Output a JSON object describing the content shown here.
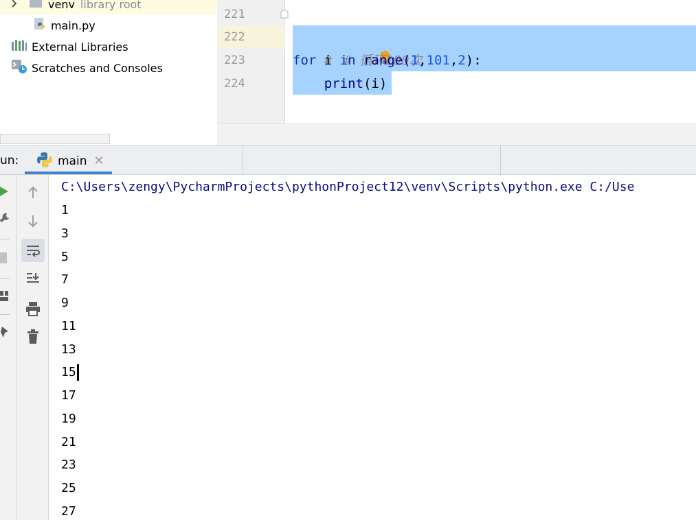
{
  "project_tree": {
    "items": [
      {
        "label": "venv",
        "suffix": "library root",
        "icon": "folder-icon"
      },
      {
        "label": "main.py",
        "icon": "python-file-icon"
      },
      {
        "label": "External Libraries",
        "icon": "libraries-icon"
      },
      {
        "label": "Scratches and Consoles",
        "icon": "scratches-icon"
      }
    ]
  },
  "editor": {
    "line_numbers": [
      "221",
      "222",
      "223",
      "224"
    ],
    "lines": {
      "comment_hash": "#",
      "comment_text": "# 循环100次",
      "for_kw": "for",
      "var_i": " i ",
      "in_kw": "in",
      "range_fn": " range(",
      "arg1": "1",
      "comma1": ",",
      "arg2": "101",
      "comma2": ",",
      "arg3": "2",
      "close": "):",
      "print_indent": "    ",
      "print_fn": "print",
      "print_args": "(i)"
    },
    "intention_bulb_icon": "lightbulb-icon"
  },
  "run_panel": {
    "label": "un:",
    "tab_name": "main",
    "tab_icon": "python-icon",
    "close_icon": "close-icon",
    "toolbar": [
      "up-arrow-icon",
      "down-arrow-icon",
      "soft-wrap-icon",
      "scroll-to-end-icon",
      "print-icon",
      "trash-icon"
    ],
    "left_toolbar": [
      "run-icon",
      "wrench-icon",
      "stop-icon",
      "layout-icon",
      "pin-icon"
    ]
  },
  "console": {
    "command": "C:\\Users\\zengy\\PycharmProjects\\pythonProject12\\venv\\Scripts\\python.exe C:/Use",
    "output": [
      "1",
      "3",
      "5",
      "7",
      "9",
      "11",
      "13",
      "15",
      "17",
      "19",
      "21",
      "23",
      "25",
      "27"
    ]
  },
  "colors": {
    "selection": "#a6d2ff",
    "keyword": "#0033b3",
    "number": "#1750eb",
    "tab_underline": "#4083c9",
    "run_green": "#4aa34a"
  }
}
